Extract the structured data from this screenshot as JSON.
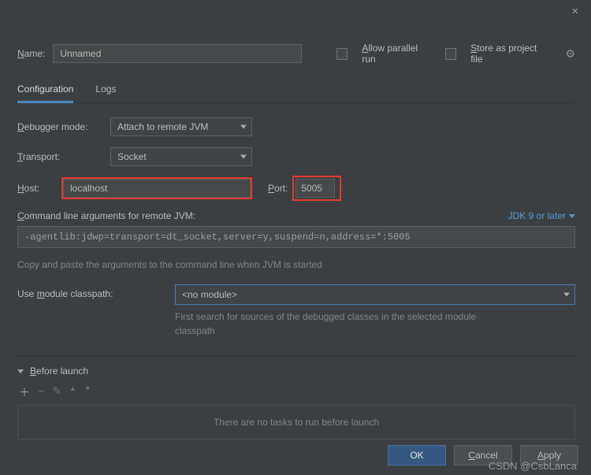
{
  "titlebar": {
    "close_icon": "×"
  },
  "name": {
    "label_pre": "N",
    "label_post": "ame:",
    "value": "Unnamed"
  },
  "checks": {
    "parallel_pre": "A",
    "parallel_post": "llow parallel run",
    "store_pre": "S",
    "store_post": "tore as project file"
  },
  "tabs": {
    "configuration": "Configuration",
    "logs": "Logs"
  },
  "form": {
    "debugger_mode_pre": "D",
    "debugger_mode_post": "ebugger mode:",
    "debugger_mode_value": "Attach to remote JVM",
    "transport_pre": "T",
    "transport_post": "ransport:",
    "transport_value": "Socket",
    "host_pre": "H",
    "host_post": "ost:",
    "host_value": "localhost",
    "port_pre": "P",
    "port_post": "ort:",
    "port_value": "5005",
    "cmd_label_pre": "C",
    "cmd_label_post": "ommand line arguments for remote JVM:",
    "jdk_link": "JDK 9 or later",
    "cmd_value": "-agentlib:jdwp=transport=dt_socket,server=y,suspend=n,address=*:5005",
    "cmd_hint": "Copy and paste the arguments to the command line when JVM is started",
    "module_label_pre": "Use ",
    "module_label_u": "m",
    "module_label_post": "odule classpath:",
    "module_value": "<no module>",
    "module_hint": "First search for sources of the debugged classes in the selected module classpath"
  },
  "before": {
    "title_pre": "B",
    "title_post": "efore launch",
    "toolbar": {
      "plus": "＋",
      "minus": "−",
      "edit": "✎",
      "up": "▲",
      "down": "▼"
    },
    "empty": "There are no tasks to run before launch"
  },
  "buttons": {
    "ok": "OK",
    "cancel_pre": "C",
    "cancel_post": "ancel",
    "apply_pre": "A",
    "apply_post": "pply"
  },
  "watermark": "CSDN @CsbLanca"
}
